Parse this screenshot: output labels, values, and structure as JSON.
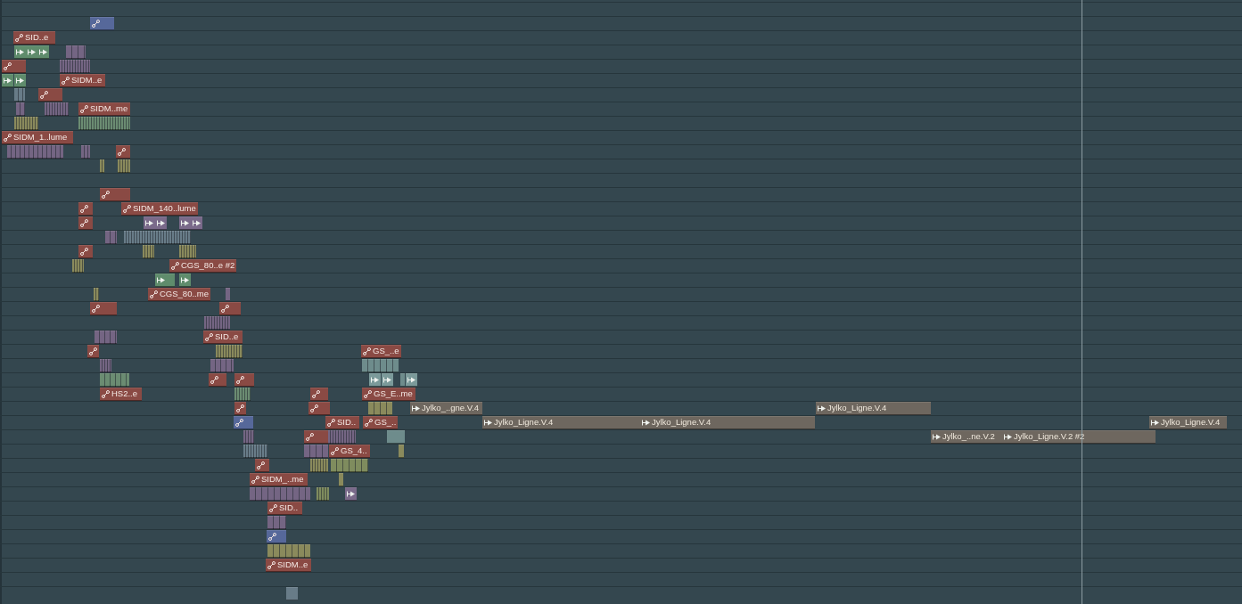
{
  "playlist": {
    "clips": [
      {
        "kind": "automation",
        "color": "#56689a"
      },
      {
        "kind": "automation",
        "label": "SID..e",
        "color": "#8a4a44"
      },
      {
        "kind": "pattern",
        "color": "#5f8c6c"
      },
      {
        "kind": "pattern",
        "color": "#5f8c6c"
      },
      {
        "kind": "pattern",
        "color": "#5f8c6c"
      },
      {
        "kind": "notes",
        "color": "#746583"
      },
      {
        "kind": "automation",
        "color": "#8a4a44"
      },
      {
        "kind": "notes",
        "color": "#746583"
      },
      {
        "kind": "pattern",
        "color": "#5f8c6c"
      },
      {
        "kind": "pattern",
        "color": "#5f8c6c"
      },
      {
        "kind": "automation",
        "label": "SIDM..e",
        "color": "#8a4a44"
      },
      {
        "kind": "notes",
        "color": "#687c88"
      },
      {
        "kind": "automation",
        "color": "#8a4a44"
      },
      {
        "kind": "notes",
        "color": "#746583"
      },
      {
        "kind": "notes",
        "color": "#746583"
      },
      {
        "kind": "automation",
        "label": "SIDM..me",
        "color": "#8a4a44"
      },
      {
        "kind": "notes",
        "color": "#8a8a5c"
      },
      {
        "kind": "notes",
        "color": "#6b8c72"
      },
      {
        "kind": "automation",
        "label": "SIDM_1..lume",
        "color": "#8a4a44"
      },
      {
        "kind": "notes",
        "color": "#746583"
      },
      {
        "kind": "notes",
        "color": "#746583"
      },
      {
        "kind": "automation",
        "color": "#8a4a44"
      },
      {
        "kind": "notes",
        "color": "#8a8a5c"
      },
      {
        "kind": "notes",
        "color": "#8a8a5c"
      },
      {
        "kind": "automation",
        "color": "#8a4a44"
      },
      {
        "kind": "automation",
        "color": "#8a4a44"
      },
      {
        "kind": "automation",
        "label": "SIDM_140..lume",
        "color": "#8a4a44"
      },
      {
        "kind": "automation",
        "color": "#8a4a44"
      },
      {
        "kind": "pattern",
        "color": "#7a6a8a"
      },
      {
        "kind": "pattern",
        "color": "#7a6a8a"
      },
      {
        "kind": "pattern",
        "color": "#7a6a8a"
      },
      {
        "kind": "pattern",
        "color": "#7a6a8a"
      },
      {
        "kind": "notes",
        "color": "#746583"
      },
      {
        "kind": "notes",
        "color": "#687c88"
      },
      {
        "kind": "automation",
        "color": "#8a4a44"
      },
      {
        "kind": "notes",
        "color": "#8a8a5c"
      },
      {
        "kind": "notes",
        "color": "#8a8a5c"
      },
      {
        "kind": "notes",
        "color": "#8a8a5c"
      },
      {
        "kind": "automation",
        "label": "CGS_80..e #2",
        "color": "#8a4a44"
      },
      {
        "kind": "pattern",
        "color": "#5f8c6c"
      },
      {
        "kind": "pattern",
        "color": "#5f8c6c"
      },
      {
        "kind": "notes",
        "color": "#8a8a5c"
      },
      {
        "kind": "automation",
        "label": "CGS_80..me",
        "color": "#8a4a44"
      },
      {
        "kind": "notes",
        "color": "#746583"
      },
      {
        "kind": "automation",
        "color": "#8a4a44"
      },
      {
        "kind": "automation",
        "color": "#8a4a44"
      },
      {
        "kind": "notes",
        "color": "#746583"
      },
      {
        "kind": "notes",
        "color": "#746583"
      },
      {
        "kind": "automation",
        "label": "SID..e",
        "color": "#8a4a44"
      },
      {
        "kind": "automation",
        "color": "#8a4a44"
      },
      {
        "kind": "notes",
        "color": "#8a8a5c"
      },
      {
        "kind": "automation",
        "label": "GS_..e",
        "color": "#8a4a44"
      },
      {
        "kind": "notes",
        "color": "#746583"
      },
      {
        "kind": "notes",
        "color": "#746583"
      },
      {
        "kind": "notes",
        "color": "#6e8c8c"
      },
      {
        "kind": "notes",
        "color": "#6b8c72"
      },
      {
        "kind": "automation",
        "color": "#8a4a44"
      },
      {
        "kind": "automation",
        "color": "#8a4a44"
      },
      {
        "kind": "pattern",
        "color": "#7b9a9a"
      },
      {
        "kind": "pattern",
        "color": "#7b9a9a"
      },
      {
        "kind": "notes",
        "color": "#6e8c8c"
      },
      {
        "kind": "pattern",
        "color": "#7b9a9a"
      },
      {
        "kind": "automation",
        "label": "HS2..e",
        "color": "#8a4a44"
      },
      {
        "kind": "notes",
        "color": "#6b8c72"
      },
      {
        "kind": "automation",
        "color": "#8a4a44"
      },
      {
        "kind": "automation",
        "label": "GS_E..me",
        "color": "#8a4a44"
      },
      {
        "kind": "automation",
        "color": "#8a4a44"
      },
      {
        "kind": "automation",
        "color": "#8a4a44"
      },
      {
        "kind": "notes",
        "color": "#8a8a5c"
      },
      {
        "kind": "pattern",
        "label": "Jylko_..gne.V.4",
        "color": "#6e675f"
      },
      {
        "kind": "pattern",
        "label": "Jylko_Ligne.V.4",
        "color": "#6e675f"
      },
      {
        "kind": "automation",
        "color": "#56689a"
      },
      {
        "kind": "automation",
        "label": "SID..",
        "color": "#8a4a44"
      },
      {
        "kind": "automation",
        "label": "GS_..",
        "color": "#8a4a44"
      },
      {
        "kind": "pattern",
        "label": "Jylko_Ligne.V.4",
        "color": "#6e675f"
      },
      {
        "kind": "pattern",
        "label": "Jylko_Ligne.V.4",
        "color": "#6e675f"
      },
      {
        "kind": "pattern",
        "label": "Jylko_Ligne.V.4",
        "color": "#6e675f"
      },
      {
        "kind": "notes",
        "color": "#746583"
      },
      {
        "kind": "automation",
        "color": "#8a4a44"
      },
      {
        "kind": "notes",
        "color": "#746583"
      },
      {
        "kind": "notes",
        "color": "#6e8c8c"
      },
      {
        "kind": "pattern",
        "label": "Jylko_..ne.V.2",
        "color": "#6e675f"
      },
      {
        "kind": "pattern",
        "label": "Jylko_Ligne.V.2 #2",
        "color": "#6e675f"
      },
      {
        "kind": "notes",
        "color": "#687c88"
      },
      {
        "kind": "notes",
        "color": "#746583"
      },
      {
        "kind": "automation",
        "label": "GS_4..",
        "color": "#8a4a44"
      },
      {
        "kind": "notes",
        "color": "#8a8a5c"
      },
      {
        "kind": "automation",
        "color": "#8a4a44"
      },
      {
        "kind": "notes",
        "color": "#8a8a5c"
      },
      {
        "kind": "notes",
        "color": "#7f8c5e"
      },
      {
        "kind": "automation",
        "label": "SIDM_..me",
        "color": "#8a4a44"
      },
      {
        "kind": "notes",
        "color": "#8a8a5c"
      },
      {
        "kind": "notes",
        "color": "#746583"
      },
      {
        "kind": "notes",
        "color": "#7f8c5e"
      },
      {
        "kind": "pattern",
        "color": "#7a6a8a"
      },
      {
        "kind": "automation",
        "label": "SID..",
        "color": "#8a4a44"
      },
      {
        "kind": "notes",
        "color": "#746583"
      },
      {
        "kind": "automation",
        "color": "#56689a"
      },
      {
        "kind": "notes",
        "color": "#8a8a5c"
      },
      {
        "kind": "automation",
        "label": "SIDM..e",
        "color": "#8a4a44"
      },
      {
        "kind": "notes",
        "color": "#687c88"
      }
    ]
  }
}
